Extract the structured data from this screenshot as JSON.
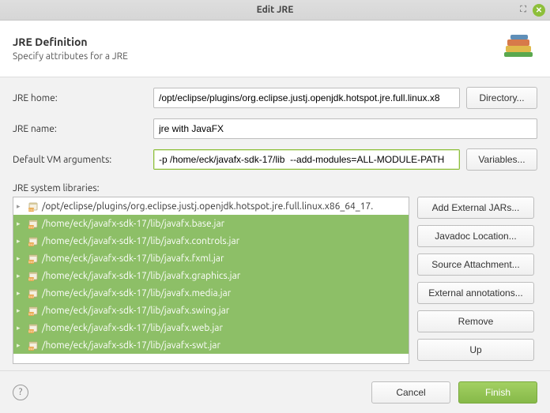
{
  "window": {
    "title": "Edit JRE"
  },
  "header": {
    "title": "JRE Definition",
    "subtitle": "Specify attributes for a JRE"
  },
  "form": {
    "jre_home_label": "JRE home:",
    "jre_home_value": "/opt/eclipse/plugins/org.eclipse.justj.openjdk.hotspot.jre.full.linux.x8",
    "directory_btn": "Directory...",
    "jre_name_label": "JRE name:",
    "jre_name_value": "jre with JavaFX",
    "vm_args_label": "Default VM arguments:",
    "vm_args_value": "-p /home/eck/javafx-sdk-17/lib  --add-modules=ALL-MODULE-PATH",
    "variables_btn": "Variables..."
  },
  "libs": {
    "label": "JRE system libraries:",
    "items": [
      {
        "path": "/opt/eclipse/plugins/org.eclipse.justj.openjdk.hotspot.jre.full.linux.x86_64_17.",
        "selected": false
      },
      {
        "path": "/home/eck/javafx-sdk-17/lib/javafx.base.jar",
        "selected": true
      },
      {
        "path": "/home/eck/javafx-sdk-17/lib/javafx.controls.jar",
        "selected": true
      },
      {
        "path": "/home/eck/javafx-sdk-17/lib/javafx.fxml.jar",
        "selected": true
      },
      {
        "path": "/home/eck/javafx-sdk-17/lib/javafx.graphics.jar",
        "selected": true
      },
      {
        "path": "/home/eck/javafx-sdk-17/lib/javafx.media.jar",
        "selected": true
      },
      {
        "path": "/home/eck/javafx-sdk-17/lib/javafx.swing.jar",
        "selected": true
      },
      {
        "path": "/home/eck/javafx-sdk-17/lib/javafx.web.jar",
        "selected": true
      },
      {
        "path": "/home/eck/javafx-sdk-17/lib/javafx-swt.jar",
        "selected": true
      }
    ],
    "buttons": {
      "add_external": "Add External JARs...",
      "javadoc": "Javadoc Location...",
      "source": "Source Attachment...",
      "annotations": "External annotations...",
      "remove": "Remove",
      "up": "Up"
    }
  },
  "footer": {
    "cancel": "Cancel",
    "finish": "Finish"
  }
}
